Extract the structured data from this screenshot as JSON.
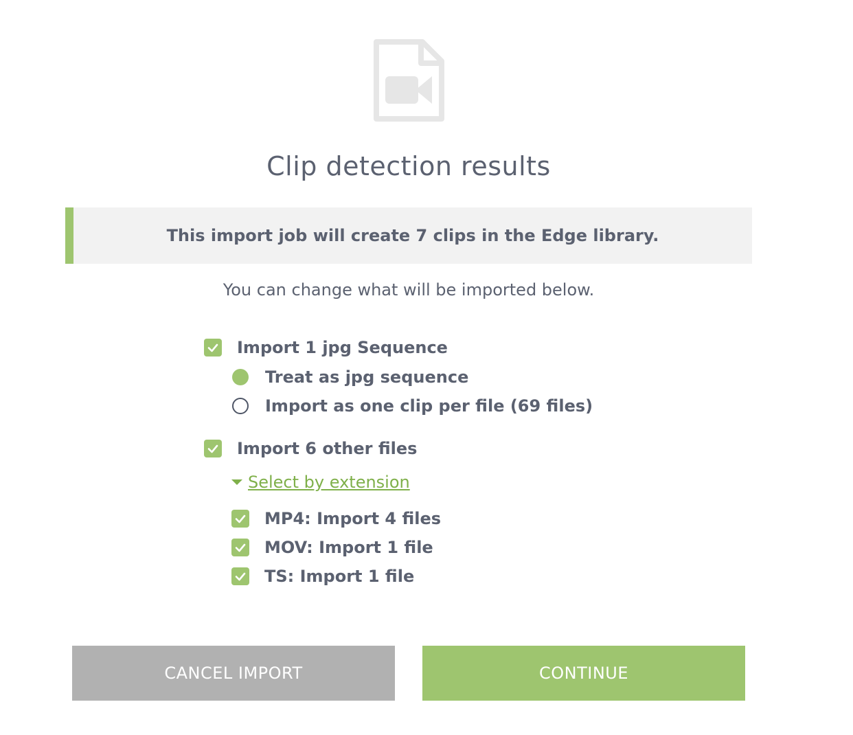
{
  "header": {
    "icon": "video-file-icon",
    "title": "Clip detection results"
  },
  "banner": {
    "text": "This import job will create 7 clips in the Edge library."
  },
  "subtitle": "You can change what will be imported below.",
  "options": {
    "sequence": {
      "label": "Import 1 jpg Sequence",
      "checked": true,
      "radio_treat": "Treat as jpg sequence",
      "radio_per_file": "Import as one clip per file (69 files)",
      "selected": "Treat as jpg sequence"
    },
    "other": {
      "label": "Import 6 other files",
      "checked": true,
      "select_by_extension": "Select by extension",
      "extensions": [
        {
          "label": "MP4: Import 4 files",
          "checked": true
        },
        {
          "label": "MOV: Import 1 file",
          "checked": true
        },
        {
          "label": "TS: Import 1 file",
          "checked": true
        }
      ]
    }
  },
  "buttons": {
    "cancel": "CANCEL IMPORT",
    "continue": "CONTINUE"
  },
  "colors": {
    "accent": "#9ec56f",
    "link": "#7fb04a",
    "text": "#5b6170",
    "cancel_bg": "#b1b1b1",
    "banner_bg": "#f2f2f2"
  }
}
